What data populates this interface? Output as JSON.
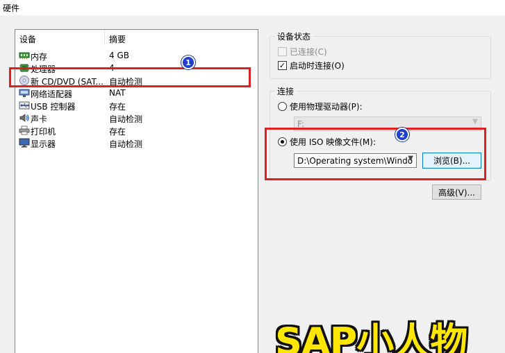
{
  "window": {
    "title": "硬件"
  },
  "device_list": {
    "headers": {
      "device": "设备",
      "summary": "摘要"
    },
    "items": [
      {
        "name": "内存",
        "summary": "4 GB",
        "icon": "memory-icon"
      },
      {
        "name": "处理器",
        "summary": "4",
        "icon": "processor-icon"
      },
      {
        "name": "新 CD/DVD (SAT...",
        "summary": "自动检测",
        "icon": "cd-dvd-icon"
      },
      {
        "name": "网络适配器",
        "summary": "NAT",
        "icon": "network-adapter-icon"
      },
      {
        "name": "USB 控制器",
        "summary": "存在",
        "icon": "usb-icon"
      },
      {
        "name": "声卡",
        "summary": "自动检测",
        "icon": "sound-card-icon"
      },
      {
        "name": "打印机",
        "summary": "存在",
        "icon": "printer-icon"
      },
      {
        "name": "显示器",
        "summary": "自动检测",
        "icon": "display-icon"
      }
    ]
  },
  "device_status": {
    "legend": "设备状态",
    "connected": {
      "label": "已连接(C)",
      "checked": false,
      "enabled": false
    },
    "connect_on_power_on": {
      "label": "启动时连接(O)",
      "checked": true,
      "enabled": true
    }
  },
  "connection": {
    "legend": "连接",
    "physical_drive": {
      "label": "使用物理驱动器(P):",
      "selected": false
    },
    "physical_drive_value": "F:",
    "iso_image": {
      "label": "使用 ISO 映像文件(M):",
      "selected": true
    },
    "iso_path": "D:\\Operating system\\Windo",
    "browse_label": "浏览(B)..."
  },
  "advanced_label": "高级(V)...",
  "annotations": {
    "badge_1": "1",
    "badge_2": "2"
  },
  "watermark": "SAP小人物",
  "colors": {
    "annotation_red": "#e02020",
    "badge_blue": "#1f3fcf",
    "watermark_yellow": "#ffe600"
  }
}
